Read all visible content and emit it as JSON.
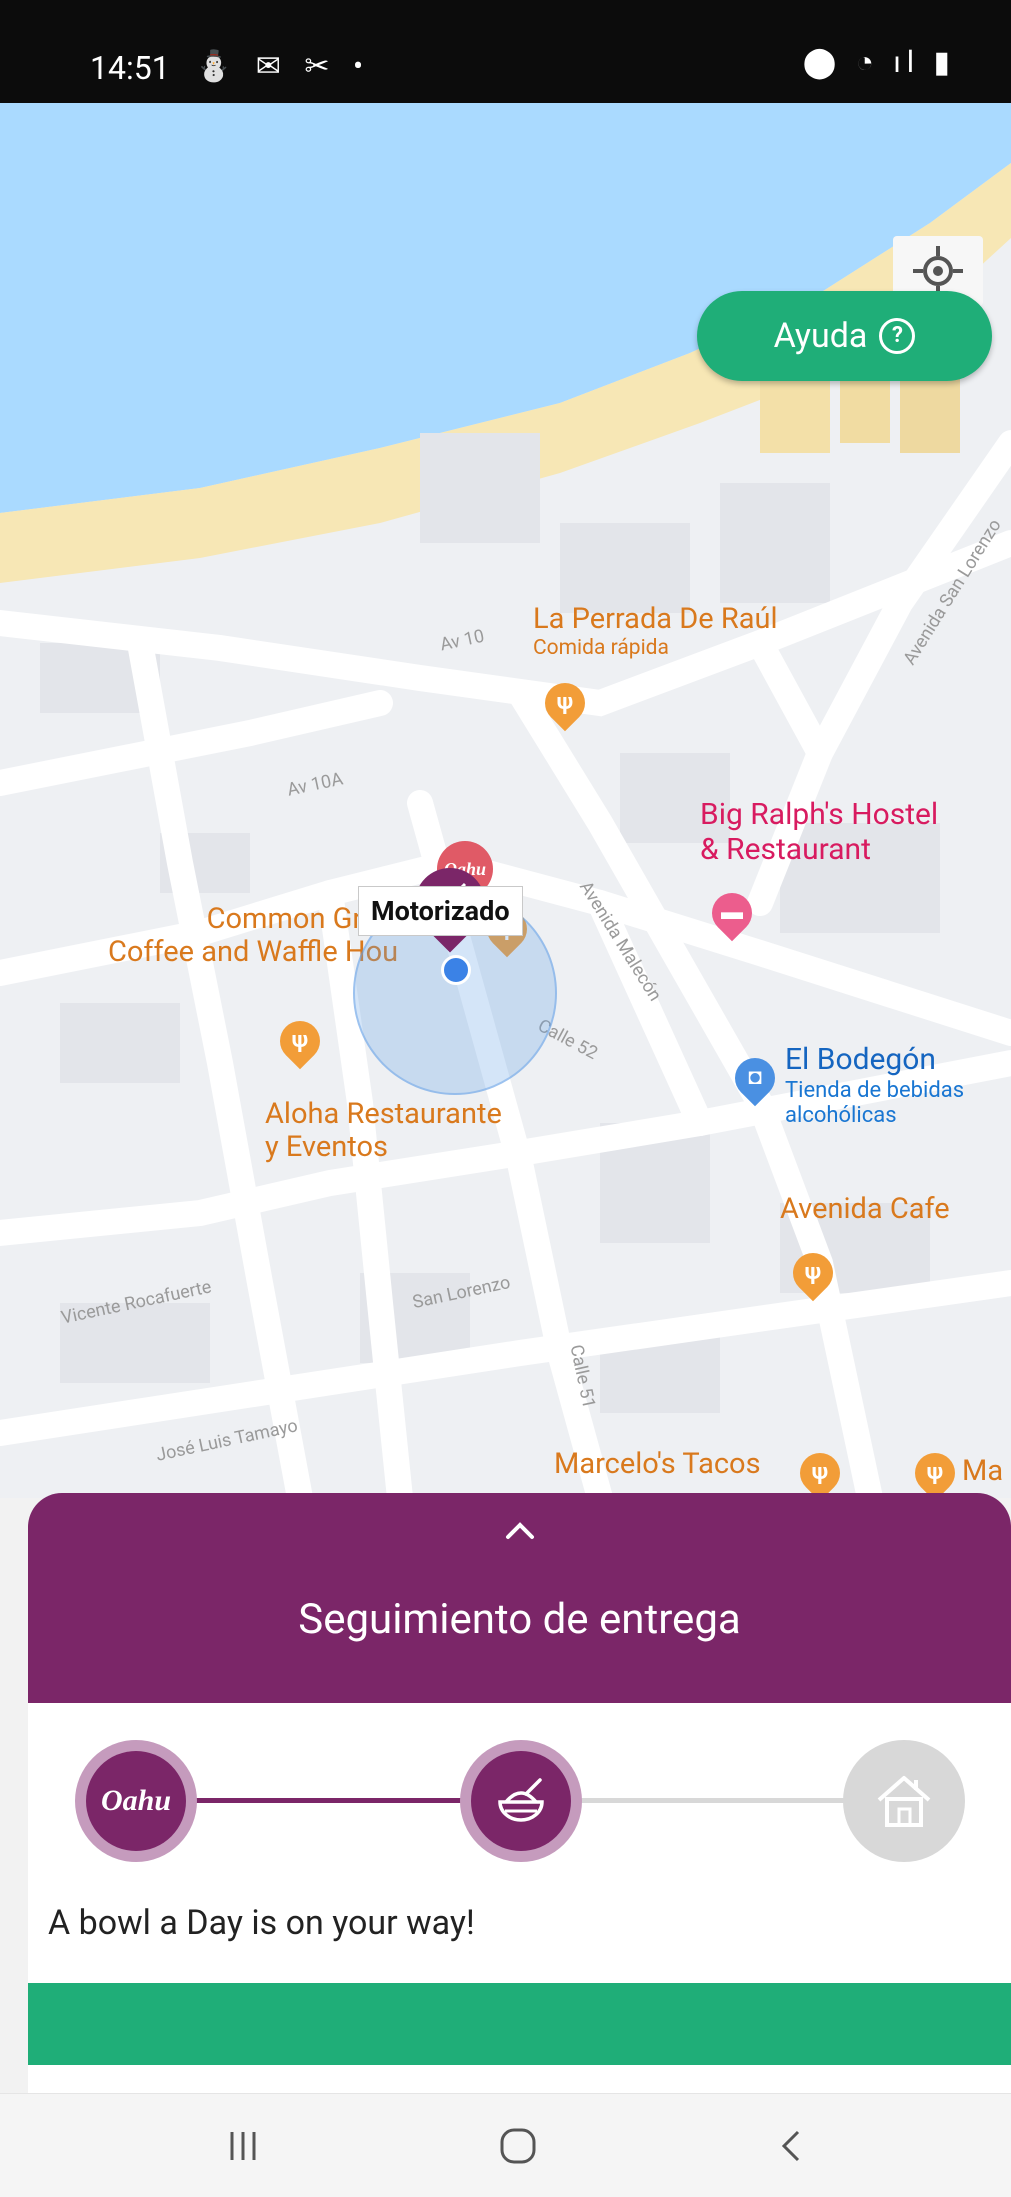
{
  "status_bar": {
    "time": "14:51",
    "left_icons": [
      "notification-icon",
      "gmail-icon",
      "missed-call-icon",
      "dot"
    ],
    "right_icons": [
      "location-icon",
      "wifi-icon",
      "signal-icon",
      "battery-icon"
    ],
    "left_icons_text": "⛄ ✉ ✂ •",
    "right_icons_text": "⬤ ◔ ıl ▮"
  },
  "map": {
    "help_button": {
      "label": "Ayuda",
      "icon": "question-circle-icon"
    },
    "courier_label": "Motorizado",
    "places": [
      {
        "name": "La Perrada De Raúl",
        "category": "Comida rápida"
      },
      {
        "name": "Big Ralph's Hostel",
        "name_line2": "& Restaurant"
      },
      {
        "name": "Common Grou",
        "name_line2": "Coffee and Waffle Hou"
      },
      {
        "name": "Aloha Restaurante",
        "name_line2": "y Eventos"
      },
      {
        "name": "El Bodegón",
        "category": "Tienda de bebidas",
        "category_line2": "alcohólicas"
      },
      {
        "name": "Avenida Cafe"
      },
      {
        "name": "Marcelo's Tacos"
      },
      {
        "name": "Ma"
      }
    ],
    "streets": [
      "Av 10",
      "Av 10A",
      "Avenida Malecón",
      "Calle 52",
      "Vicente Rocafuerte",
      "San Lorenzo",
      "Calle 51",
      "José Luis Tamayo",
      "Avenida San Lorenzo"
    ],
    "store_pin_text": "Oahu",
    "colors": {
      "water": "#aadaff",
      "sand": "#f7e7b5",
      "road": "#ffffff",
      "block": "#e9ebef"
    }
  },
  "delivery": {
    "title": "Seguimiento de entrega",
    "steps": [
      {
        "id": "store",
        "label": "Oahu",
        "state": "done"
      },
      {
        "id": "courier",
        "icon": "bowl-icon",
        "state": "active"
      },
      {
        "id": "home",
        "icon": "home-icon",
        "state": "pending"
      }
    ],
    "message": "A bowl a Day is on your way!",
    "progress": 0.5,
    "colors": {
      "primary": "#7b2668",
      "primary_light": "#c59bbd",
      "accent": "#1fae78",
      "pending": "#d8d8d8"
    }
  },
  "nav_bar": {
    "buttons": [
      "recents-icon",
      "home-button-icon",
      "back-icon"
    ]
  }
}
